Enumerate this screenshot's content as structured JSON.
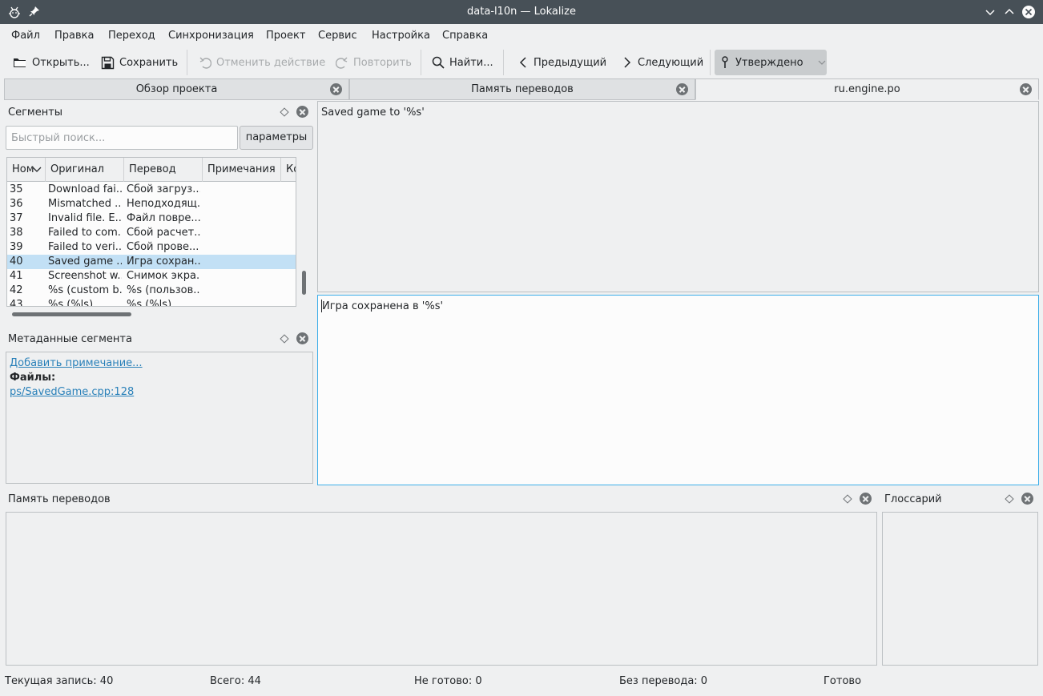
{
  "window": {
    "title": "data-l10n — Lokalize"
  },
  "menu": [
    "Файл",
    "Правка",
    "Переход",
    "Синхронизация",
    "Проект",
    "Сервис",
    "Настройка",
    "Справка"
  ],
  "toolbar": {
    "open": "Открыть...",
    "save": "Сохранить",
    "undo": "Отменить действие",
    "redo": "Повторить",
    "find": "Найти...",
    "prev": "Предыдущий",
    "next": "Следующий",
    "approved": "Утверждено"
  },
  "tabs": [
    {
      "label": "Обзор проекта"
    },
    {
      "label": "Память переводов"
    },
    {
      "label": "ru.engine.po"
    }
  ],
  "segments": {
    "title": "Сегменты",
    "search_placeholder": "Быстрый поиск...",
    "params_button": "параметры",
    "columns": [
      "Ном",
      "Оригинал",
      "Перевод",
      "Примечания",
      "Ко"
    ],
    "rows": [
      {
        "num": "35",
        "original": "Download fai...",
        "translation": "Сбой загруз..."
      },
      {
        "num": "36",
        "original": "Mismatched ...",
        "translation": "Неподходящ..."
      },
      {
        "num": "37",
        "original": "Invalid file. E...",
        "translation": "Файл повре..."
      },
      {
        "num": "38",
        "original": "Failed to com...",
        "translation": "Сбой расчет..."
      },
      {
        "num": "39",
        "original": "Failed to veri...",
        "translation": "Сбой прове..."
      },
      {
        "num": "40",
        "original": "Saved game ...",
        "translation": "Игра сохран...",
        "selected": true
      },
      {
        "num": "41",
        "original": "Screenshot w...",
        "translation": "Снимок экра..."
      },
      {
        "num": "42",
        "original": "%s (custom b...",
        "translation": "%s (пользов..."
      },
      {
        "num": "43",
        "original": "%s (%ls)",
        "translation": "%s (%ls)"
      }
    ]
  },
  "metadata": {
    "title": "Метаданные сегмента",
    "add_note": "Добавить примечание...",
    "files_label": "Файлы:",
    "file_link": "ps/SavedGame.cpp:128"
  },
  "editor": {
    "source": "Saved game to '%s'",
    "target": "Игра сохранена в '%s'"
  },
  "tm_panel": {
    "title": "Память переводов"
  },
  "glossary_panel": {
    "title": "Глоссарий"
  },
  "statusbar": {
    "current": "Текущая запись: 40",
    "total": "Всего: 44",
    "fuzzy": "Не готово: 0",
    "untranslated": "Без перевода: 0",
    "state": "Готово"
  }
}
